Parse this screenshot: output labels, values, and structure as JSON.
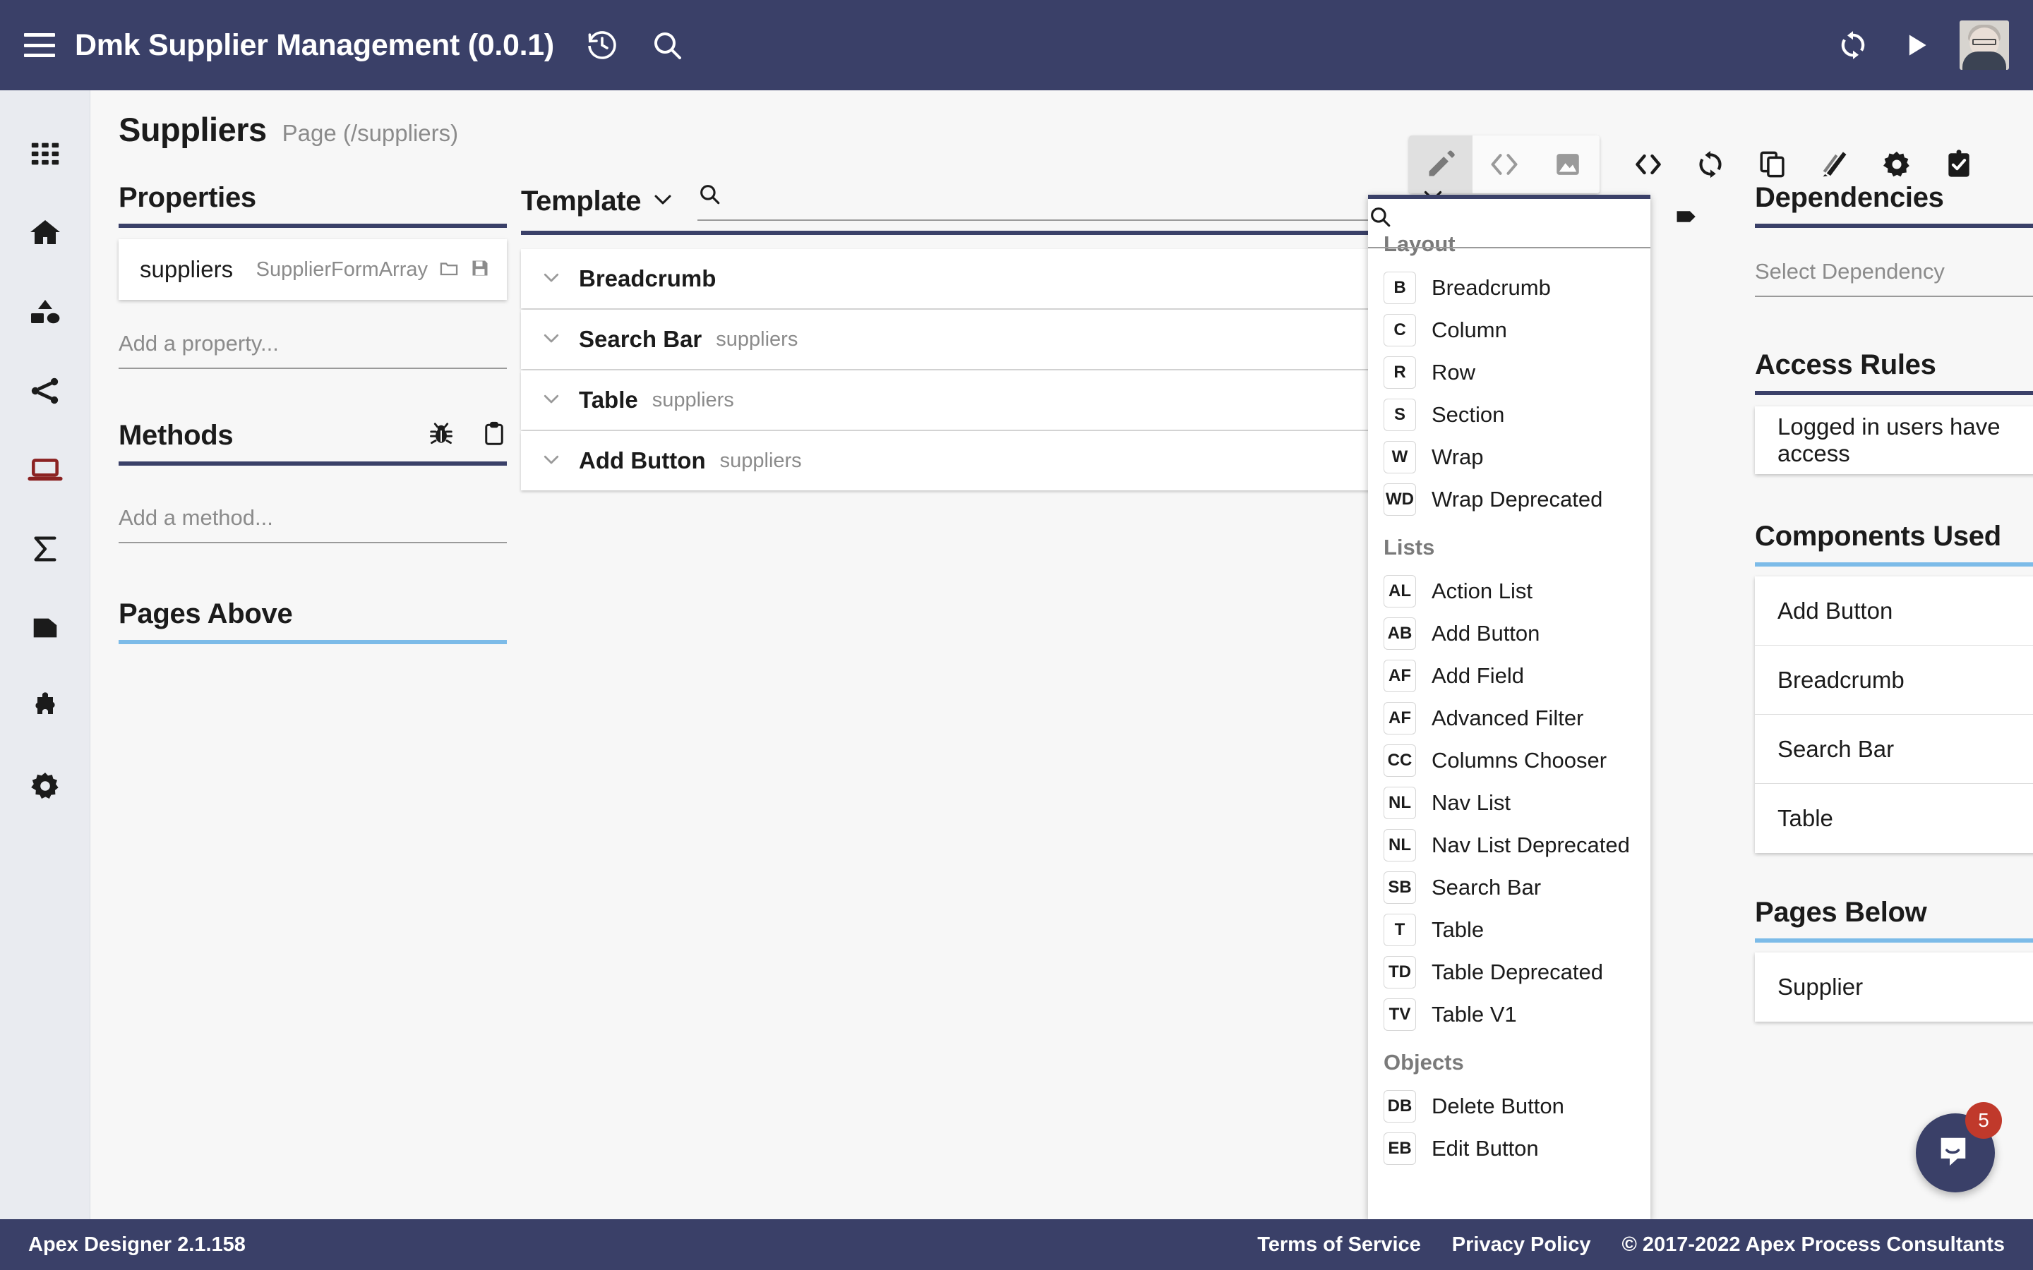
{
  "appbar": {
    "title": "Dmk Supplier Management (0.0.1)",
    "icons": [
      "menu-icon",
      "history-icon",
      "search-icon",
      "sync-icon",
      "play-icon",
      "avatar"
    ]
  },
  "page": {
    "title": "Suppliers",
    "subtitle": "Page (/suppliers)"
  },
  "toolbar": {
    "segmented": [
      {
        "name": "edit-mode",
        "icon": "pencil-icon",
        "active": true
      },
      {
        "name": "code-mode",
        "icon": "code-icon",
        "active": false
      },
      {
        "name": "image-mode",
        "icon": "image-icon",
        "active": false
      }
    ],
    "actions": [
      {
        "name": "source-code",
        "icon": "code-angle-icon"
      },
      {
        "name": "refresh",
        "icon": "sync-icon"
      },
      {
        "name": "duplicate",
        "icon": "copy-icon"
      },
      {
        "name": "theme",
        "icon": "palette-icon"
      },
      {
        "name": "settings",
        "icon": "gear-icon"
      },
      {
        "name": "tasks",
        "icon": "clipboard-check-icon"
      }
    ]
  },
  "rail": {
    "items": [
      {
        "name": "apps",
        "icon": "grid-icon",
        "active": false
      },
      {
        "name": "home",
        "icon": "home-icon",
        "active": false
      },
      {
        "name": "objects",
        "icon": "shapes-icon",
        "active": false
      },
      {
        "name": "relationships",
        "icon": "share-icon",
        "active": false
      },
      {
        "name": "pages",
        "icon": "laptop-icon",
        "active": true
      },
      {
        "name": "functions",
        "icon": "sigma-icon",
        "active": false
      },
      {
        "name": "documents",
        "icon": "file-icon",
        "active": false
      },
      {
        "name": "plugins",
        "icon": "puzzle-icon",
        "active": false
      },
      {
        "name": "settings",
        "icon": "gear-icon",
        "active": false
      }
    ]
  },
  "properties": {
    "heading": "Properties",
    "rows": [
      {
        "name": "suppliers",
        "type": "SupplierFormArray",
        "icons": [
          "folder-icon",
          "save-icon"
        ]
      }
    ],
    "add_placeholder": "Add a property..."
  },
  "methods": {
    "heading": "Methods",
    "icons": [
      "bug-icon",
      "clipboard-icon"
    ],
    "add_placeholder": "Add a method..."
  },
  "pages_above": {
    "heading": "Pages Above",
    "items": []
  },
  "template": {
    "heading": "Template",
    "search_value": "",
    "search_placeholder": "",
    "items": [
      {
        "name": "Breadcrumb",
        "sub": ""
      },
      {
        "name": "Search Bar",
        "sub": "suppliers"
      },
      {
        "name": "Table",
        "sub": "suppliers"
      },
      {
        "name": "Add Button",
        "sub": "suppliers"
      }
    ]
  },
  "picker": {
    "search_value": "",
    "search_placeholder": "",
    "tag_icon": "tag-icon",
    "groups": [
      {
        "name": "Layout",
        "items": [
          {
            "badge": "B",
            "label": "Breadcrumb"
          },
          {
            "badge": "C",
            "label": "Column"
          },
          {
            "badge": "R",
            "label": "Row"
          },
          {
            "badge": "S",
            "label": "Section"
          },
          {
            "badge": "W",
            "label": "Wrap"
          },
          {
            "badge": "WD",
            "label": "Wrap Deprecated"
          }
        ]
      },
      {
        "name": "Lists",
        "items": [
          {
            "badge": "AL",
            "label": "Action List"
          },
          {
            "badge": "AB",
            "label": "Add Button"
          },
          {
            "badge": "AF",
            "label": "Add Field"
          },
          {
            "badge": "AF",
            "label": "Advanced Filter"
          },
          {
            "badge": "CC",
            "label": "Columns Chooser"
          },
          {
            "badge": "NL",
            "label": "Nav List"
          },
          {
            "badge": "NL",
            "label": "Nav List Deprecated"
          },
          {
            "badge": "SB",
            "label": "Search Bar"
          },
          {
            "badge": "T",
            "label": "Table"
          },
          {
            "badge": "TD",
            "label": "Table Deprecated"
          },
          {
            "badge": "TV",
            "label": "Table V1"
          }
        ]
      },
      {
        "name": "Objects",
        "items": [
          {
            "badge": "DB",
            "label": "Delete Button"
          },
          {
            "badge": "EB",
            "label": "Edit Button"
          }
        ]
      }
    ]
  },
  "dependencies": {
    "heading": "Dependencies",
    "select_placeholder": "Select Dependency"
  },
  "access_rules": {
    "heading": "Access Rules",
    "value": "Logged in users have access"
  },
  "components_used": {
    "heading": "Components Used",
    "items": [
      "Add Button",
      "Breadcrumb",
      "Search Bar",
      "Table"
    ]
  },
  "pages_below": {
    "heading": "Pages Below",
    "items": [
      "Supplier"
    ]
  },
  "footer": {
    "version": "Apex Designer 2.1.158",
    "terms": "Terms of Service",
    "privacy": "Privacy Policy",
    "copyright": "© 2017-2022 Apex Process Consultants"
  },
  "intercom": {
    "badge": "5",
    "icon": "chat-icon"
  },
  "colors": {
    "brand": "#3a4068",
    "accent_light": "#7cbbe8",
    "active_rail": "#8b2222",
    "badge_red": "#c0392b"
  }
}
